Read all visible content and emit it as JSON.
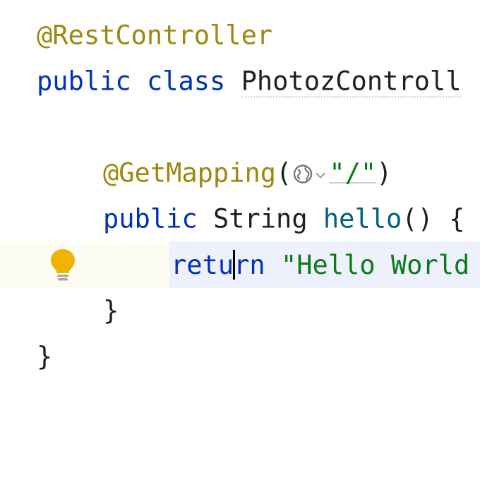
{
  "editor": {
    "lines": [
      {
        "annotation": "@RestController"
      },
      {
        "kw_public": "public",
        "kw_class": "class",
        "class_name": "PhotozControll"
      },
      {},
      {
        "annotation_name": "@GetMapping",
        "open_paren": "(",
        "arg": "\"/\"",
        "close_paren": ")"
      },
      {
        "kw_public": "public",
        "type": "String",
        "method": "hello",
        "rest": "() {"
      },
      {
        "kw_return_before": "retu",
        "kw_return_after": "rn",
        "string": "\"Hello World"
      },
      {
        "brace": "}"
      },
      {
        "brace": "}"
      }
    ]
  },
  "icons": {
    "intention_bulb": "lightbulb-icon",
    "endpoint_globe": "globe-icon",
    "endpoint_dropdown": "chevron-down-icon"
  },
  "colors": {
    "keyword": "#0033b3",
    "annotation": "#9e880d",
    "method": "#00627a",
    "string": "#067d17",
    "current_line_bg": "#eef0fb",
    "bulb": "#f0b400"
  }
}
